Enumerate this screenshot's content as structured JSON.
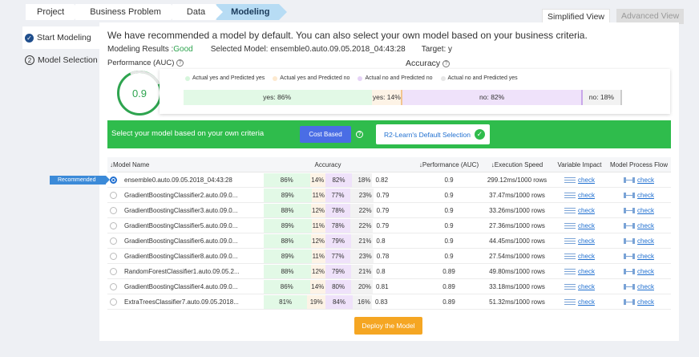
{
  "breadcrumb": [
    "Project",
    "Business Problem",
    "Data",
    "Modeling"
  ],
  "views": {
    "simplified": "Simplified View",
    "advanced": "Advanced View"
  },
  "nav": {
    "start": "Start Modeling",
    "selection_num": "2",
    "selection": "Model Selection"
  },
  "headline": "We have recommended a model by default. You can also select your own model based on your business criteria.",
  "results": {
    "label": "Modeling Results : ",
    "status": "Good",
    "selected": "Selected Model: ensemble0.auto.09.05.2018_04:43:28",
    "target": "Target: y"
  },
  "perf": {
    "label": "Performance (AUC)",
    "value": "0.9"
  },
  "accuracy": {
    "title": "Accuracy",
    "legend": [
      "Actual yes and Predicted yes",
      "Actual yes and Predicted no",
      "Actual no and Predicted no",
      "Actual no and Predicted yes"
    ],
    "segments": [
      {
        "label": "yes: 86%",
        "share": 86,
        "color": "#e2f9e6",
        "edge": "#e2f9e6"
      },
      {
        "label": "yes: 14%",
        "share": 14,
        "color": "#fdf3e6",
        "edge": "#f2c58f"
      },
      {
        "label": "no: 82%",
        "share": 82,
        "color": "#efe2fa",
        "edge": "#c9a8ea"
      },
      {
        "label": "no: 18%",
        "share": 18,
        "color": "#f2f2f2",
        "edge": "#cccccc"
      }
    ]
  },
  "criteria": {
    "text": "Select your model based on your own criteria",
    "cost_btn": "Cost Based",
    "help": "?",
    "default_btn": "R2-Learn's Default Selection",
    "check": "✓"
  },
  "recommended_tag": "Recommended",
  "table": {
    "headers": {
      "name": "↓Model Name",
      "accuracy": "Accuracy",
      "perf": "↓Performance (AUC)",
      "speed": "↓Execution Speed",
      "vi": "Variable Impact",
      "mpf": "Model Process Flow"
    },
    "link_label": "check",
    "rows": [
      {
        "name": "ensemble0.auto.09.05.2018_04:43:28",
        "a": "86%",
        "b": "14%",
        "c": "82%",
        "d": "18%",
        "acc": "0.82",
        "auc": "0.9",
        "speed": "299.12ms/1000 rows",
        "selected": true
      },
      {
        "name": "GradientBoostingClassifier2.auto.09.0...",
        "a": "89%",
        "b": "11%",
        "c": "77%",
        "d": "23%",
        "acc": "0.79",
        "auc": "0.9",
        "speed": "37.47ms/1000 rows",
        "selected": false
      },
      {
        "name": "GradientBoostingClassifier3.auto.09.0...",
        "a": "88%",
        "b": "12%",
        "c": "78%",
        "d": "22%",
        "acc": "0.79",
        "auc": "0.9",
        "speed": "33.26ms/1000 rows",
        "selected": false
      },
      {
        "name": "GradientBoostingClassifier5.auto.09.0...",
        "a": "89%",
        "b": "11%",
        "c": "78%",
        "d": "22%",
        "acc": "0.79",
        "auc": "0.9",
        "speed": "27.36ms/1000 rows",
        "selected": false
      },
      {
        "name": "GradientBoostingClassifier6.auto.09.0...",
        "a": "88%",
        "b": "12%",
        "c": "79%",
        "d": "21%",
        "acc": "0.8",
        "auc": "0.9",
        "speed": "44.45ms/1000 rows",
        "selected": false
      },
      {
        "name": "GradientBoostingClassifier8.auto.09.0...",
        "a": "89%",
        "b": "11%",
        "c": "77%",
        "d": "23%",
        "acc": "0.78",
        "auc": "0.9",
        "speed": "27.54ms/1000 rows",
        "selected": false
      },
      {
        "name": "RandomForestClassifier1.auto.09.05.2...",
        "a": "88%",
        "b": "12%",
        "c": "79%",
        "d": "21%",
        "acc": "0.8",
        "auc": "0.89",
        "speed": "49.80ms/1000 rows",
        "selected": false
      },
      {
        "name": "GradientBoostingClassifier4.auto.09.0...",
        "a": "86%",
        "b": "14%",
        "c": "80%",
        "d": "20%",
        "acc": "0.81",
        "auc": "0.89",
        "speed": "33.18ms/1000 rows",
        "selected": false
      },
      {
        "name": "ExtraTreesClassifier7.auto.09.05.2018...",
        "a": "81%",
        "b": "19%",
        "c": "84%",
        "d": "16%",
        "acc": "0.83",
        "auc": "0.89",
        "speed": "51.32ms/1000 rows",
        "selected": false
      }
    ]
  },
  "deploy": "Deploy the Model"
}
